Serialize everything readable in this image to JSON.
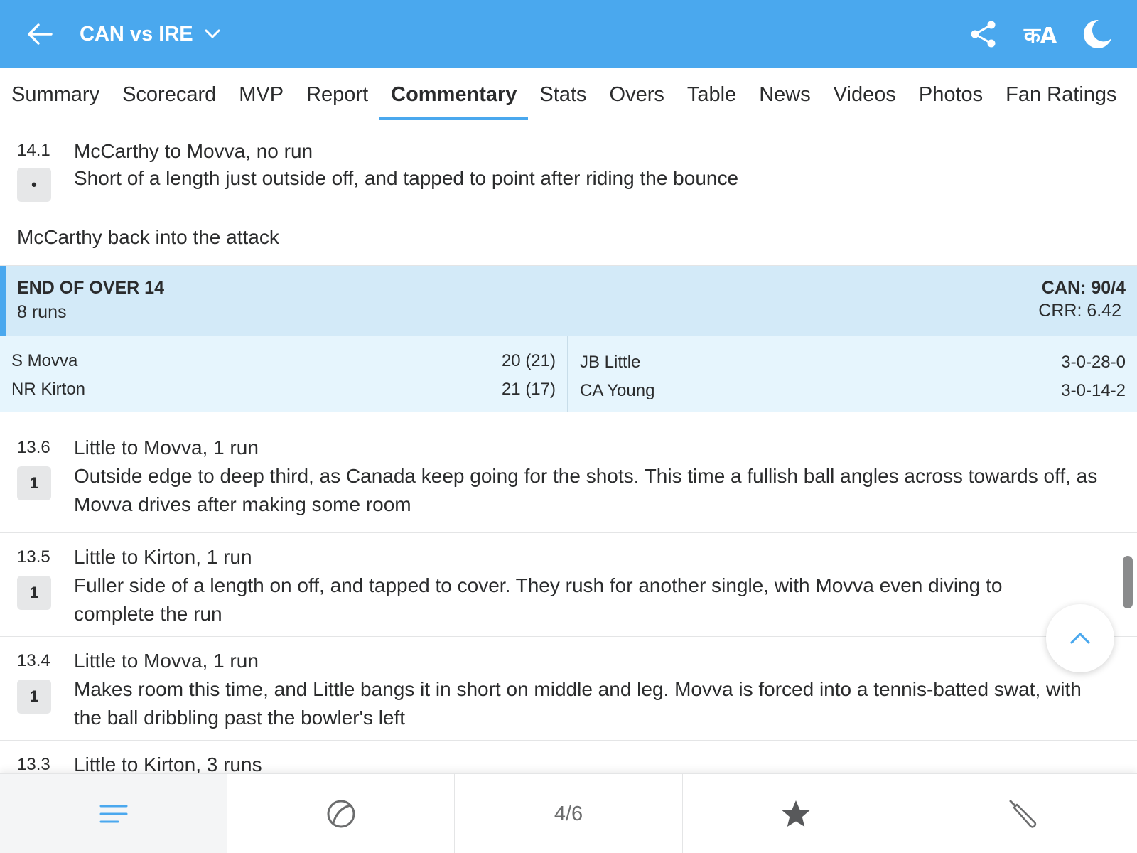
{
  "header": {
    "title": "CAN vs IRE",
    "lang_label": "कA",
    "accent_color": "#4aa8ee"
  },
  "tabs": [
    {
      "label": "Summary"
    },
    {
      "label": "Scorecard"
    },
    {
      "label": "MVP"
    },
    {
      "label": "Report"
    },
    {
      "label": "Commentary",
      "active": true
    },
    {
      "label": "Stats"
    },
    {
      "label": "Overs"
    },
    {
      "label": "Table"
    },
    {
      "label": "News"
    },
    {
      "label": "Videos"
    },
    {
      "label": "Photos"
    },
    {
      "label": "Fan Ratings"
    }
  ],
  "top_ball": {
    "over": "14.1",
    "badge": "•",
    "headline": "McCarthy to Movva, no run",
    "desc": "Short of a length just outside off, and tapped to point after riding the bounce"
  },
  "note": "McCarthy back into the attack",
  "end_of_over": {
    "title": "END OF OVER 14",
    "runs": "8 runs",
    "score": "CAN: 90/4",
    "crr": "CRR: 6.42",
    "batters": [
      {
        "name": "S Movva",
        "stat": "20 (21)"
      },
      {
        "name": "NR Kirton",
        "stat": "21 (17)"
      }
    ],
    "bowlers": [
      {
        "name": "JB Little",
        "stat": "3-0-28-0"
      },
      {
        "name": "CA Young",
        "stat": "3-0-14-2"
      }
    ]
  },
  "balls": [
    {
      "over": "13.6",
      "badge": "1",
      "headline": "Little to Movva, 1 run",
      "desc": "Outside edge to deep third, as Canada keep going for the shots. This time a fullish ball angles across towards off, as Movva drives after making some room"
    },
    {
      "over": "13.5",
      "badge": "1",
      "headline": "Little to Kirton, 1 run",
      "desc": "Fuller side of a length on off, and tapped to cover. They rush for another single, with Movva even diving to complete the run"
    },
    {
      "over": "13.4",
      "badge": "1",
      "headline": "Little to Movva, 1 run",
      "desc": "Makes room this time, and Little bangs it in short on middle and leg. Movva is forced into a tennis-batted swat, with the ball dribbling past the bowler's left"
    },
    {
      "over": "13.3",
      "badge": "",
      "headline": "Little to Kirton, 3 runs",
      "desc": ""
    }
  ],
  "bottom_nav": {
    "page_indicator": "4/6",
    "items": [
      "menu-icon",
      "ball-icon",
      "page-indicator",
      "star-icon",
      "bat-icon"
    ]
  }
}
